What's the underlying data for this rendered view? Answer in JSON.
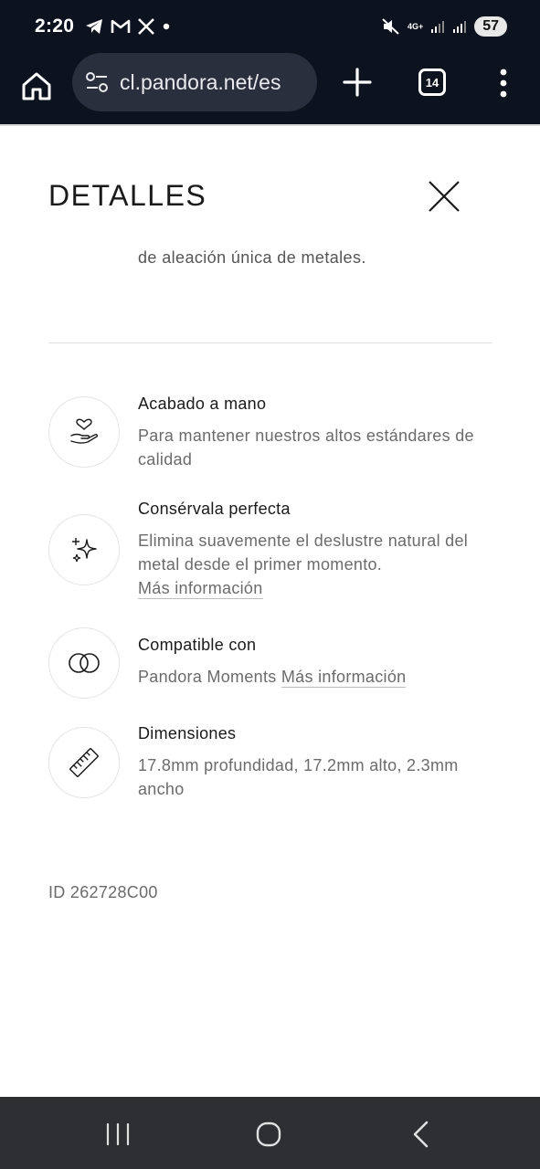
{
  "status_bar": {
    "time": "2:20",
    "network_label": "4G+",
    "battery": "57"
  },
  "browser": {
    "url": "cl.pandora.net/es",
    "tab_count": "14"
  },
  "panel": {
    "title": "DETALLES",
    "intro": "de aleación única de metales.",
    "features": [
      {
        "icon": "hand-heart-icon",
        "title": "Acabado a mano",
        "desc": "Para mantener nuestros altos estándares de calidad"
      },
      {
        "icon": "sparkles-icon",
        "title": "Consérvala perfecta",
        "desc": "Elimina suavemente el deslustre natural del metal desde el primer momento.",
        "link": "Más información"
      },
      {
        "icon": "interlocked-rings-icon",
        "title": "Compatible con",
        "desc": "Pandora Moments",
        "link": "Más información"
      },
      {
        "icon": "ruler-icon",
        "title": "Dimensiones",
        "desc": "17.8mm profundidad, 17.2mm alto, 2.3mm ancho"
      }
    ],
    "product_id": "ID 262728C00"
  },
  "colors": {
    "chrome_bg": "#0d121f",
    "url_pill_bg": "#2a2f3d",
    "nav_bar_bg": "#2d2f33",
    "text_primary": "#1a1a1a",
    "text_secondary": "#6b6b6b"
  }
}
